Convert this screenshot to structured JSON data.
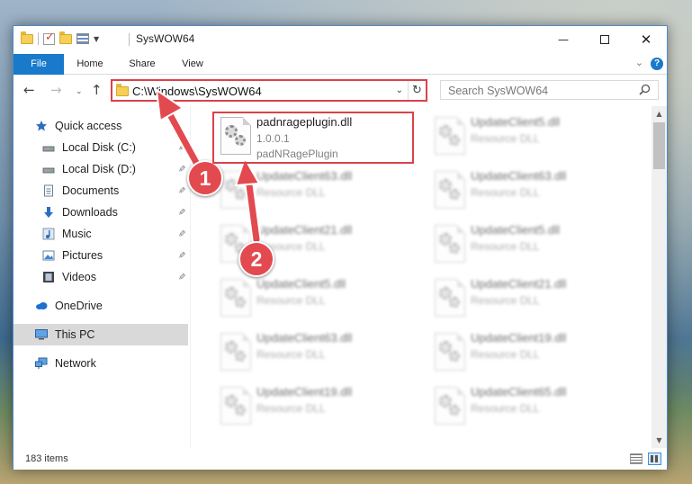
{
  "window": {
    "title": "SysWOW64",
    "controls": {
      "minimize": "—",
      "maximize": "",
      "close": "✕"
    }
  },
  "ribbon": {
    "tabs": [
      "File",
      "Home",
      "Share",
      "View"
    ],
    "collapse": "⌄",
    "help": "?"
  },
  "nav": {
    "back": "←",
    "forward": "→",
    "recent": "⌄",
    "up": "↑",
    "address": "C:\\Windows\\SysWOW64",
    "address_dropdown": "⌄",
    "refresh": "↻",
    "search_placeholder": "Search SysWOW64"
  },
  "navpane": {
    "items": [
      {
        "label": "Quick access",
        "icon": "star-icon",
        "pinned": false
      },
      {
        "label": "Local Disk (C:)",
        "icon": "drive-icon",
        "pinned": true
      },
      {
        "label": "Local Disk (D:)",
        "icon": "drive-icon",
        "pinned": true
      },
      {
        "label": "Documents",
        "icon": "documents-icon",
        "pinned": true
      },
      {
        "label": "Downloads",
        "icon": "downloads-icon",
        "pinned": true
      },
      {
        "label": "Music",
        "icon": "music-icon",
        "pinned": true
      },
      {
        "label": "Pictures",
        "icon": "pictures-icon",
        "pinned": true
      },
      {
        "label": "Videos",
        "icon": "videos-icon",
        "pinned": true
      },
      {
        "label": "OneDrive",
        "icon": "cloud-icon",
        "pinned": false
      },
      {
        "label": "This PC",
        "icon": "computer-icon",
        "pinned": false,
        "selected": true
      },
      {
        "label": "Network",
        "icon": "network-icon",
        "pinned": false
      }
    ],
    "pin_glyph": "📌"
  },
  "files": {
    "column1": [
      {
        "name": "padnrageplugin.dll",
        "version": "1.0.0.1",
        "description": "padNRagePlugin",
        "highlighted": true
      },
      {
        "name": "UpdateClient63.dll",
        "description": "Resource DLL"
      },
      {
        "name": "UpdateClient21.dll",
        "description": "Resource DLL"
      },
      {
        "name": "UpdateClient5.dll",
        "description": "Resource DLL"
      },
      {
        "name": "UpdateClient63.dll",
        "description": "Resource DLL"
      },
      {
        "name": "UpdateClient19.dll",
        "description": "Resource DLL"
      }
    ],
    "column2": [
      {
        "name": "UpdateClient5.dll",
        "description": "Resource DLL"
      },
      {
        "name": "UpdateClient63.dll",
        "description": "Resource DLL"
      },
      {
        "name": "UpdateClient5.dll",
        "description": "Resource DLL"
      },
      {
        "name": "UpdateClient21.dll",
        "description": "Resource DLL"
      },
      {
        "name": "UpdateClient19.dll",
        "description": "Resource DLL"
      },
      {
        "name": "UpdateClient65.dll",
        "description": "Resource DLL"
      }
    ]
  },
  "status": {
    "item_count": "183 items"
  },
  "annotations": {
    "step1": "1",
    "step2": "2",
    "color": "#e24a50"
  }
}
